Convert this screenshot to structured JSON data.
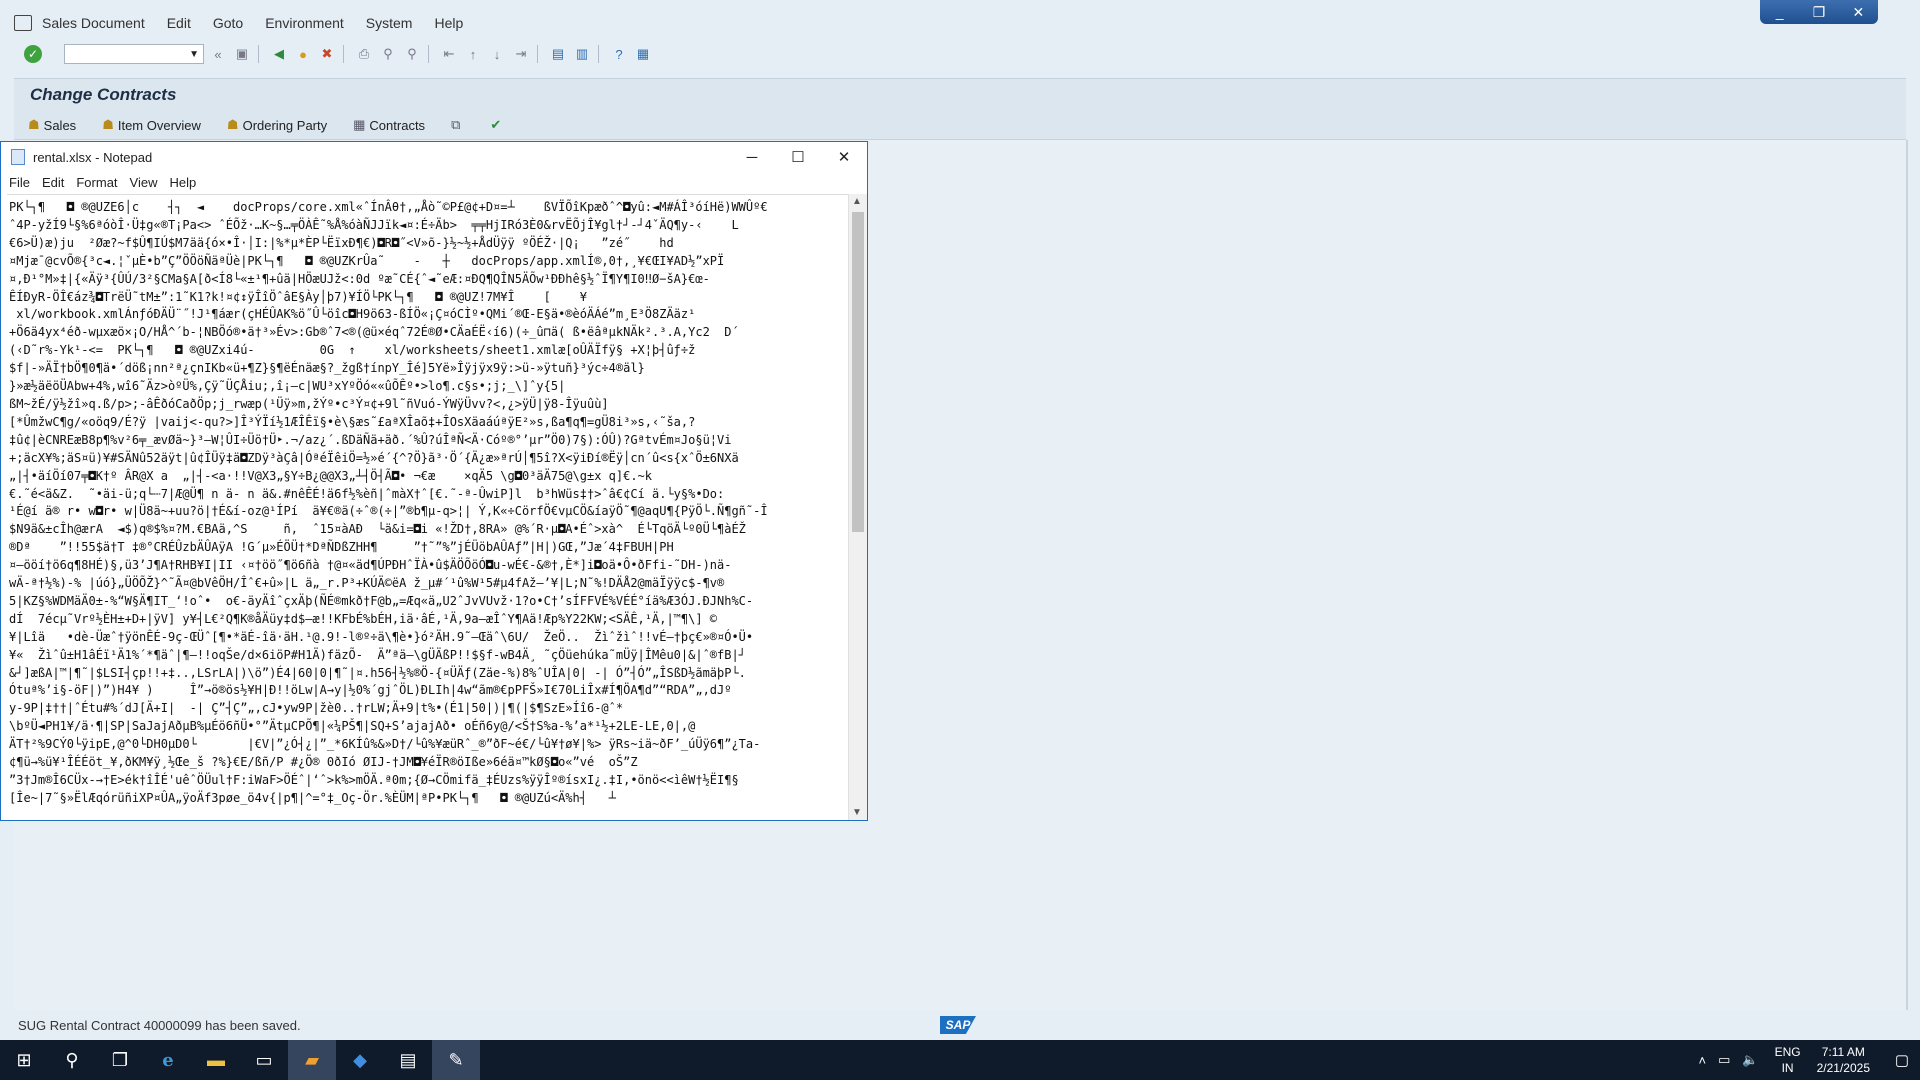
{
  "sap": {
    "menu": [
      "Sales Document",
      "Edit",
      "Goto",
      "Environment",
      "System",
      "Help"
    ],
    "window_controls": [
      "_",
      "❐",
      "✕"
    ],
    "command_field": "",
    "title": "Change Contracts",
    "app_toolbar": [
      "Sales",
      "Item Overview",
      "Ordering Party",
      "Contracts"
    ],
    "status_message": "SUG Rental Contract 40000099 has been saved.",
    "logo": "SAP"
  },
  "notepad": {
    "title": "rental.xlsx - Notepad",
    "menu": [
      "File",
      "Edit",
      "Format",
      "View",
      "Help"
    ],
    "content": "PK└┐¶   ◘ ®@UZE6│c    ┤┐  ◄    docProps/core.xml«ˆÍnÂθ†,„Åò˜©P£@¢+D¤=┴    ßVÏÕîKpæðˆ^◘yû:◄M#ÁÎ³óíHë)WWÛº€\nˆ4P-yžÍ9└§%6ªóòÎ·Ü‡g«®T¡Pa<> ˆÉÕž·…K~§…╤ÖÀÊ˜%Å%óàÑJJïk◄¤:É÷Äb>  ╤╤HjIRó3È0&rvËÕjÎ¥gl†┘-┘4ˇÄQ¶y-‹    L\n€6>Ü)æ)ju  ²Øæ?~f$Û¶IÚ$M7ää{ó×•Î·│I:|%*µ*ÈP└ËïxÐ¶€)◘R◘˝<V»õ-}½~½+ÅdÜÿÿ ºÖÉŽ·|Q¡   ”zé˝    hd\n¤Mjæ¯@cvÕ®{³c◄.¦ˇµÈ•b”Ç”ÖÖöÑäªÜè|PK└┐¶   ◘ ®@UZKrÛa˜    -   ┼   docProps/app.xmlÍ®,0†,¸¥€ŒI¥AD½”xPÏ\n¤,Ð¹°M»‡|{«Äÿ³{ÛÚ/3²§CMa§A[ð<Í8└«±¹¶+ûä|HÖæUJž<:0d ºæ˜CÉ{ˆ◄˜eÆ:¤ÐQ¶QÎN5ÄÕw¹ÐÐhê§½ˆÏ¶Y¶I0‼Ø−šA}€œ-\nÊÍÐyR-ÖÎ€áz¾◘TrëÜ˜tM±”:­1˜K1?k!¤¢↕ÿÎîÖˆâE§Ày│þ7)¥ÍÖ└PK└┐¶   ◘ ®@UZ!7M¥Î    [    ¥\n xl/workbook.xmlÁnƒóÐÄÜ¨˝!J¹¶áær(çHÉÛAK%ö˝Û└öîc◘H9ö63-ßÍÖ«¡Ç¤óCÌº•QMi´®Œ-E§ä•®èóÄÁé”m¸E³Ö8ZÄäz¹\n+Ö6ä4yx⁴éð-wµxæö×¡O/HÅ^´b-¦NBÖó®•ä†³»Év>:Gb®ˆ7<®(@ü×éqˆ72É®Ø•CÄaÉË‹í6)(÷_û⊓ä( ß•ëâªµkNÄk².³.A,Yc2  D´\n(‹D˜r%-Yk¹-<=  PK└┐¶   ◘ ®@UZxi4ú-         0G  ↑    xl/worksheets/sheet1.xmlæ[oÛÄÏfÿ§ +X¦þ┤ûƒ÷ž\n$f|-»ÄÏ†bÖ¶0¶ä•´döß¡nn²ª¿çnIKb«ü+¶Z}§¶ëÉnäæ§?_žgß†ínpY_Îé]5Yë»Îÿjÿx9ÿ:>ü-»ÿtuñ}³ýc÷4®äl}\n}»æ½äëöÜAbw+4%,wî6˜Äz>òºÜ%,Çÿ˜ÜÇÅiu;,î¡—c|WU³xYºÖó««ûÕÊº•>lo¶.c§s•;j;_\\]ˆy{5|\nßM~žÉ/ÿ½žî»q.ß/p>;-âÊðóCaðÖp;j_rwæp(¹Üÿ»m,žÝº•c³Ý¤¢+9l˜ñVuó-ÝWÿÜvv?<,¿>ÿÜ|ÿ8-Îÿuûù]\n[*ÛmžwC¶g/«oöq9/É?ÿ |vaij<-qu?>]Î³ÝÏí½1ÆÎÊï§•è\\§æs˜£aªXÎaõ‡+ÎOsXäaáúªÿE²»s,ßa¶q¶=gÜ8i³»s,‹˜ša,?\n‡û¢|èCNREæB8p¶%v²6╤_ævØä~}³–W¦ÛI÷Üö†Ü‣.¬/az¿´.ßDäÑä+äð.´%Û?úÎªÑ<Ä·Cóº®°’µr”Ö0)7§):ÓÛ)?GªtvÉm¤Jo§ü¦Vi\n+;äcX¥%;äS¤ü)¥#SÄNû52äÿt|û¢ÎÜÿ‡ä◘ZDÿ³àÇâ|ÓªéÏêiÖ=½»é´{^?Ö}ã³·Ö´{Ä¿æ»ªrÚ│¶5î?X<ÿiÐí®Ëÿ│cn´û<s{xˆÖ±6NXä\n„|┤•äíÖí07╤◘K†º ÂR@X a  „|┤-<a·!!V@X3„§Y÷B¿@@X3„┴┤Ö┤Ã◘• ¬€æ    ×qÄ5 \\g◘0³äÄ75@\\g±x q]€.~k\n€.˜é<ä&Z.  ˜•äi-ü;q└┄7|Æ@Ü¶ n ä- n ä&.#nêÊÉ!ä6f½%èñ|ˆmàX†ˆ[€.˜-ª-ÛwiP]l  b³hWüs‡†>ˆâ€¢Cí ä.└y§%•Do:\n¹É@í ä® r• w◘r• w|Ü8ä~+uu?ö|†É&í-oz@¹ÍPí  ä¥€®ä(÷ˆ®(÷|”®b¶µ-q>¦| Ý,K«÷CörfÖ€vµCÖ&íaÿÖ˜¶@aqU¶{PÿÖ└.Ñ¶gñ˜-Î\n$N9ä&±cÎh@ærA  ◄$)q®$%¤?M.€BAä,^S     ñ,  ˆ15¤àAÐ  └ä&i=◘i «!ŽD†,8RA» @%´R·µ◘A•Éˆ>xà^  É└TqöÄ└º0Ü└¶àÉŽ\n®Dª    ”!!55$ä†T ‡®°CRÉÛzbÄÛAÿA !G´µ»ÉÖÜ†*DªÑDßZHH¶     ”†˜”%”jÉÜöbAÛAƒ”|H|)GŒ,”Jæ´4‡FBUH|PH\n¤–ööí†ö6q¶8HÉ)§,ü3’J¶A†RHB¥I|II ‹¤†öö˝¶ö6ñà †@¤«äd¶ÚPÐHˆÏÀ•û$ÄÖÕöÓ◘u-wÉ€-&®†,È*]i◘oä•Ô•ðFfi-˜DH-)nä-\nwÄ-ª†½%)-% |úó}„ÜÖÕŽ}^˜Ã¤@bVêÖH/Îˆ€+û»|L ä„_r.P³+KÚÄ©ëA ž_µ#´¹û%W¹5#µ4fAž–’¥|L;N˜%!DÄÅ2@mäÏÿÿc$-¶v®\n5|KZ§%WDMäÄ0±-%“W§Ä¶IT_‘!oˆ•  o€-äyÄîˆçxÄþ(ÑÉ®mkð†F@b„=Æq«ä„U2ˆJvVUvž·1?o•C†’sÍFFVÉ%VÉÉ°íä%Æ3ÓJ.ÐJNh%C-\ndÍ  7écµ˜Vrº½ÈH±+D+|ÿV] y¥┤L€²Q¶K®åÄüy‡d$–æ!!KFbÉ%bÉH,iä·âÉ,¹Ä,9a–æÎˆY¶Aä!Æp%Y22KW;<SÄÊ,¹Ä,|™¶\\] ©\n¥|Lîä   •dè-Üæˆ†ÿönÊÉ-9ç-ŒÜˆ[¶•*äÉ-îä·äH.¹@.9!-l®º÷ä\\¶è•}ó²ÄH.9˜–Œäˆ\\6U/  ŽeÖ..  Žìˆžìˆ!!vÉ–†þç€»®¤Ó•Ü•\n¥«  Žìˆû±H1âÉï¹Ä1%´*¶äˆ­|¶–!!oqŠe/d×6iöP#H1Ä)fäzÕ-  Ä”ªä–\\gÜÄßP!!$§f-wB4Ä¸ ˜çÖüehúka˜mÜÿ|ÎMêu0|&|ˆ®fB|┘\n&┘]æßA|™|¶˜|$LSI┤çp!!+‡..,LSrLA|)\\ö”)É4|60|0|¶˜|¤.h56┤½%®Ö-{¤ÜÄƒ(Zäe-%)8%ˆUÎA|0| -| Ó”┤Ó”„ÎSßD½ãmäþP└.\nÓtuª%’i§-öF|)”)H4¥ )     Î”→ö®ös½¥H|Ð!!öLw|A→y|½0%´gjˆÖL)ÐLIh|4w“ãm®€pPFŠ»I€70LiÎx#Í¶ÖA¶d”“RDA”„,dJº\ny-9P|‡††|ˆÉtu#%´dJ[Ä+I|  -| Ç”┤Ç”„,cJ•yw9P|žè0..†rLW;Ä+9|t%•(É1|50|)|¶(|$¶SzE»Íî6-@ˆ*\n\\bºÜ◄PH1¥/ä·¶|SP|SaJajAðµB%µÉö6ñÜ•°”ÄtµCPÕ¶|«¼PŠ¶|SQ+S’ajajAð• oÉñ6y@/<Š†S%a-%’a*¹½+2LE-LE,0|,@\nÄT†²%9CÝ0└ÿipE,@^0└DH0µD0└       |€V|”¿Ó┤¿|”_*6KÍû%&»D†/└û%¥æüRˆ_®”ðF~é€/└û¥†ø¥|%> ÿRs~iä~ðF’_úÜÿ6¶”¿Ta-\n¢¶ü→%ü¥¹ÎÉÉöt_¥,ðKM¥ÿ¸½Œe_š ?%}€E/ßñ/P #¿Ö® 0ðIó ØIJ-†JM◘¥éÏR®öIße»6éä¤™kØ§◘o«”vé  oŠ”Z\n”3†Jm®Î6CÜx-→†E>ék†îÎÉ'uêˆÖÜul†F:iWaF>ÖÉˆ|‘ˆ>k%>mÖÄ.ª0m;{Ø→CÖmifä_‡ÉUzs%ÿÿÎº®ísxI¿.‡I,•önö<<ìêW†½ËI¶§\n[Îe~|7˜§»ËlÆqórüñiXP¤ÛA„ÿoÄf3pøe_ö4v{|p¶|^=°‡_Oç-Ör.%ÈÜM|ªP•PK└┐¶   ◘ ®@UZú<Ä%h┤   ┴"
  },
  "taskbar": {
    "language": [
      "ENG",
      "IN"
    ],
    "time": "7:11 AM",
    "date": "2/21/2025"
  }
}
